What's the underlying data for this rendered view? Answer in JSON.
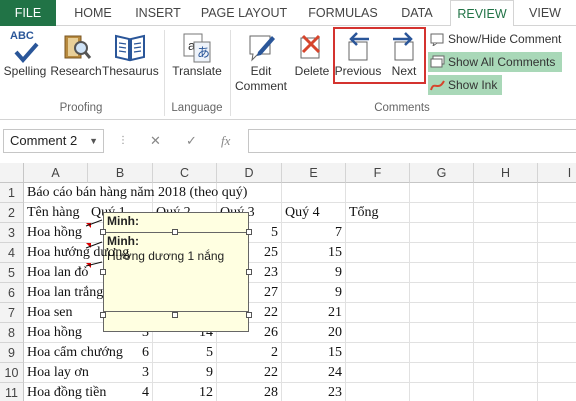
{
  "ribbon_tabs": [
    "FILE",
    "HOME",
    "INSERT",
    "PAGE LAYOUT",
    "FORMULAS",
    "DATA",
    "REVIEW",
    "VIEW"
  ],
  "active_tab": "REVIEW",
  "proofing": {
    "group_label": "Proofing",
    "spelling": "Spelling",
    "spelling_abc": "ABC",
    "research": "Research",
    "thesaurus": "Thesaurus"
  },
  "language": {
    "group_label": "Language",
    "translate": "Translate"
  },
  "comments": {
    "group_label": "Comments",
    "edit_comment_line1": "Edit",
    "edit_comment_line2": "Comment",
    "delete": "Delete",
    "previous": "Previous",
    "next": "Next",
    "show_hide": "Show/Hide Comment",
    "show_all": "Show All Comments",
    "show_ink": "Show Ink"
  },
  "formula_bar": {
    "name_box": "Comment 2",
    "fx": "fx"
  },
  "columns": [
    "A",
    "B",
    "C",
    "D",
    "E",
    "F",
    "G",
    "H",
    "I"
  ],
  "rows": [
    {
      "num": "1",
      "A": "Báo cáo bán hàng năm 2018 (theo quý)",
      "B": "",
      "C": "",
      "D": "",
      "E": "",
      "F": ""
    },
    {
      "num": "2",
      "A": "Tên hàng",
      "B": "Quý 1",
      "C": "Quý 2",
      "D": "Quý 3",
      "E": "Quý 4",
      "F": "Tổng"
    },
    {
      "num": "3",
      "A": "Hoa hồng",
      "B": "",
      "C": "",
      "D": "5",
      "E": "7",
      "F": ""
    },
    {
      "num": "4",
      "A": "Hoa hướng dương",
      "B": "",
      "C": "",
      "D": "25",
      "E": "15",
      "F": ""
    },
    {
      "num": "5",
      "A": "Hoa lan đỏ",
      "B": "",
      "C": "",
      "D": "23",
      "E": "9",
      "F": ""
    },
    {
      "num": "6",
      "A": "Hoa lan trắng",
      "B": "",
      "C": "",
      "D": "27",
      "E": "9",
      "F": ""
    },
    {
      "num": "7",
      "A": "Hoa sen",
      "B": "",
      "C": "",
      "D": "22",
      "E": "21",
      "F": ""
    },
    {
      "num": "8",
      "A": "Hoa hồng",
      "B": "3",
      "C": "14",
      "D": "26",
      "E": "20",
      "F": ""
    },
    {
      "num": "9",
      "A": "Hoa cẩm chướng",
      "B": "6",
      "C": "5",
      "D": "2",
      "E": "15",
      "F": ""
    },
    {
      "num": "10",
      "A": "Hoa lay ơn",
      "B": "3",
      "C": "9",
      "D": "22",
      "E": "24",
      "F": ""
    },
    {
      "num": "11",
      "A": "Hoa đồng tiền",
      "B": "4",
      "C": "12",
      "D": "28",
      "E": "23",
      "F": ""
    }
  ],
  "comment_back": {
    "author": "Minh:"
  },
  "comment_front": {
    "author": "Minh:",
    "text": "Hướng dương 1 nắng"
  }
}
